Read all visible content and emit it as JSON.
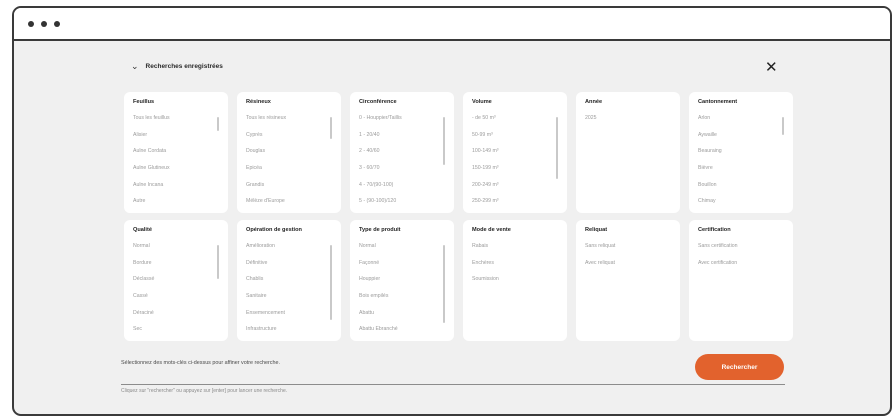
{
  "saved_searches": {
    "label": "Recherches enregistrées"
  },
  "filters": [
    {
      "title": "Feuillus",
      "options": [
        "Tous les feuillus",
        "Alisier",
        "Aulne Cordata",
        "Aulne Glutineux",
        "Aulne Incana",
        "Autre"
      ]
    },
    {
      "title": "Résineux",
      "options": [
        "Tous les résineux",
        "Cyprès",
        "Douglas",
        "Epicéa",
        "Grandis",
        "Mélèze d'Europe"
      ]
    },
    {
      "title": "Circonférence",
      "options": [
        "0 - Houppier/Taillis",
        "1 - 20/40",
        "2 - 40/60",
        "3 - 60/70",
        "4 - 70/(90-100)",
        "5 - (90-100)/120"
      ]
    },
    {
      "title": "Volume",
      "options": [
        "- de 50 m³",
        "50-99 m³",
        "100-149 m³",
        "150-199 m³",
        "200-249 m³",
        "250-299 m³"
      ]
    },
    {
      "title": "Année",
      "options": [
        "2025"
      ]
    },
    {
      "title": "Cantonnement",
      "options": [
        "Arlon",
        "Aywaille",
        "Beauraing",
        "Bièvre",
        "Bouillon",
        "Chimay"
      ]
    },
    {
      "title": "Qualité",
      "options": [
        "Normal",
        "Bordure",
        "Déclassé",
        "Cassé",
        "Déraciné",
        "Sec"
      ]
    },
    {
      "title": "Opération de gestion",
      "options": [
        "Amélioration",
        "Définitive",
        "Chablis",
        "Sanitaire",
        "Ensemencement",
        "Infrastructure"
      ]
    },
    {
      "title": "Type de produit",
      "options": [
        "Normal",
        "Façonné",
        "Houppier",
        "Bois empilés",
        "Abattu",
        "Abattu Ebranché"
      ]
    },
    {
      "title": "Mode de vente",
      "options": [
        "Rabais",
        "Enchères",
        "Soumission"
      ]
    },
    {
      "title": "Reliquat",
      "options": [
        "Sans reliquat",
        "Avec reliquat"
      ]
    },
    {
      "title": "Certification",
      "options": [
        "Sans certification",
        "Avec certification"
      ]
    }
  ],
  "hint_text": "Sélectionnez des mots-clés ci-dessus pour affiner votre recherche.",
  "search_button": {
    "label": "Rechercher"
  },
  "footer_note": "Cliquez sur \"rechercher\" ou appuyez sur [enter] pour lancer une recherche.",
  "colors": {
    "accent": "#e2622d",
    "background": "#f0f0f0",
    "card": "#ffffff"
  },
  "icons": {
    "close": "close-icon",
    "chevron": "chevron-down-icon"
  }
}
